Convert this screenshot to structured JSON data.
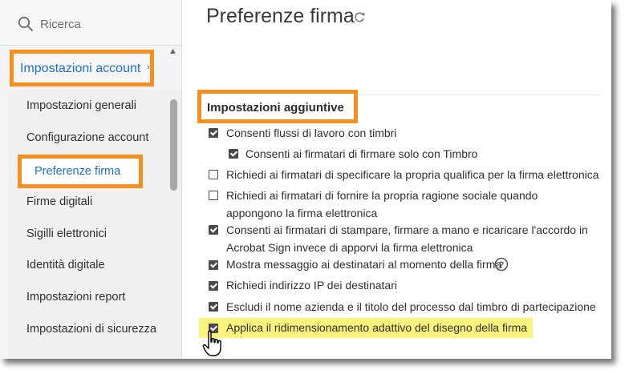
{
  "search": {
    "placeholder": "Ricerca"
  },
  "sidebar": {
    "account_settings_label": "Impostazioni account",
    "items": [
      {
        "label": "Impostazioni generali"
      },
      {
        "label": "Configurazione account"
      },
      {
        "label": "Preferenze firma",
        "selected": true
      },
      {
        "label": "Firme digitali"
      },
      {
        "label": "Sigilli elettronici"
      },
      {
        "label": "Identità digitale"
      },
      {
        "label": "Impostazioni report"
      },
      {
        "label": "Impostazioni di sicurezza"
      }
    ]
  },
  "main": {
    "title": "Preferenze firma",
    "section_title": "Impostazioni aggiuntive",
    "options": [
      {
        "label": "Consenti flussi di lavoro con timbri",
        "checked": true
      },
      {
        "label": "Consenti ai firmatari di firmare solo con Timbro",
        "checked": true
      },
      {
        "label": "Richiedi ai firmatari di specificare la propria qualifica per la firma elettronica",
        "checked": false
      },
      {
        "label": "Richiedi ai firmatari di fornire la propria ragione sociale quando appongono la firma elettronica",
        "checked": false
      },
      {
        "label": "Consenti ai firmatari di stampare, firmare a mano e ricaricare l'accordo in Acrobat Sign invece di apporvi la firma elettronica",
        "checked": true
      },
      {
        "label": "Mostra messaggio ai destinatari al momento della firma",
        "checked": true
      },
      {
        "label": "Richiedi indirizzo IP dei destinatari",
        "checked": true
      },
      {
        "label": "Escludi il nome azienda e il titolo del processo dal timbro di partecipazione",
        "checked": true
      },
      {
        "label": "Applica il ridimensionamento adattivo del disegno della firma",
        "checked": true,
        "highlighted": true
      }
    ]
  },
  "colors": {
    "accent_orange": "#f5901e",
    "link_blue": "#1f6fc5",
    "highlight_yellow": "#fbf47c"
  },
  "icons": {
    "search": "search-icon",
    "refresh": "refresh-icon",
    "help": "help-icon",
    "cursor": "hand-pointer-icon"
  }
}
